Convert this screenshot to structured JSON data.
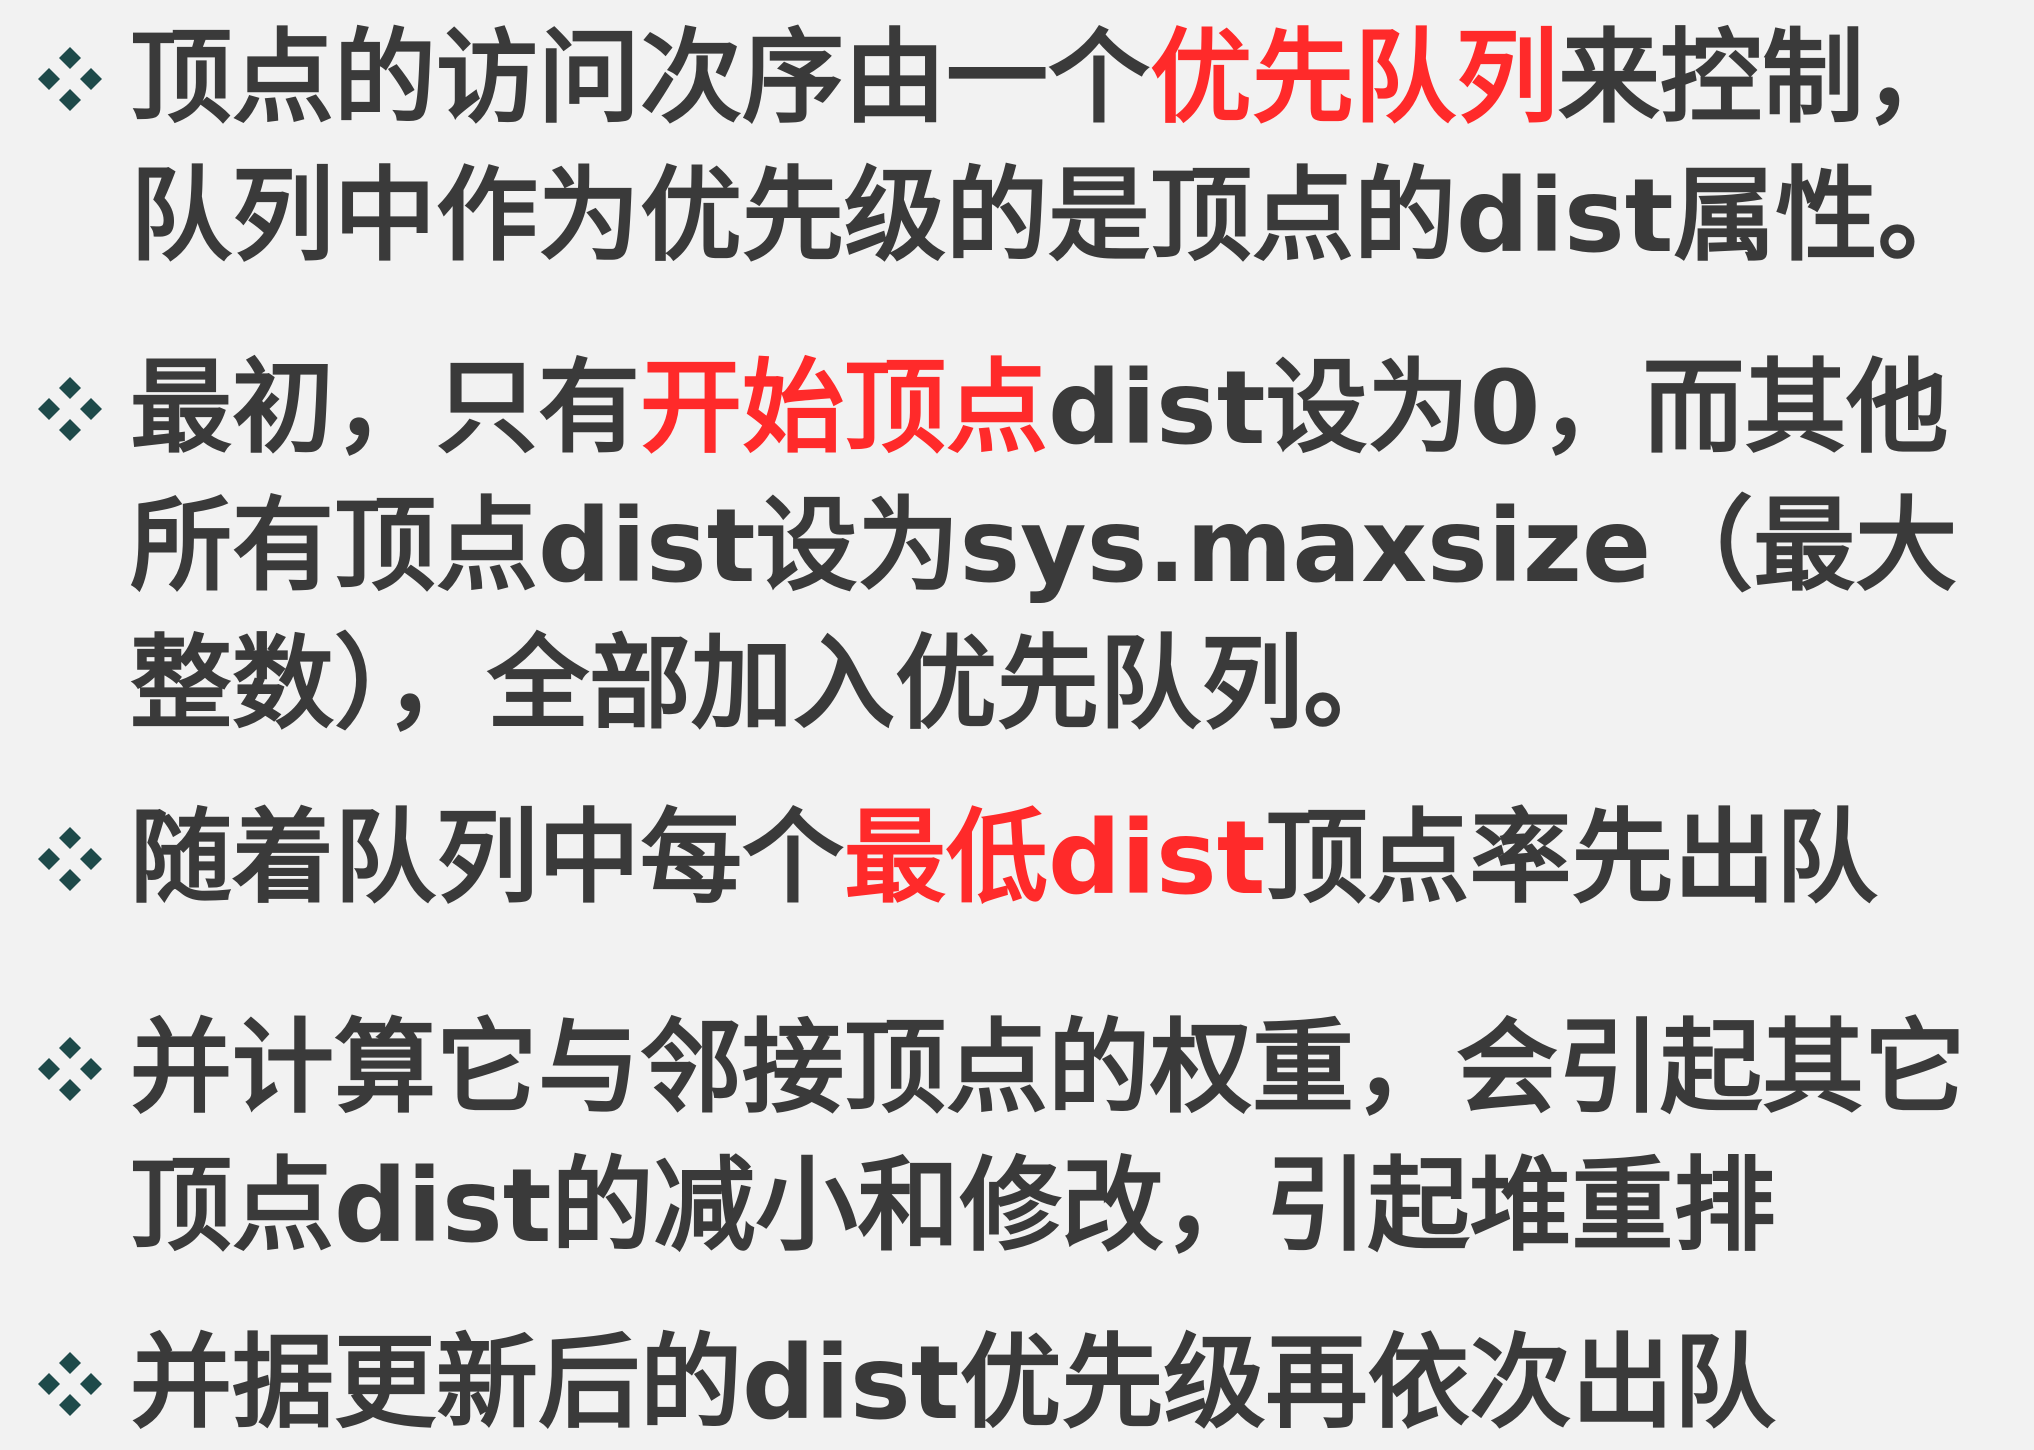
{
  "colors": {
    "text": "#3a3a3a",
    "highlight": "#ff2a2a",
    "marker": "#1e4a4a",
    "background": "#f2f2f2"
  },
  "bullets": [
    {
      "marker_icon": "four-diamond-bullet-icon",
      "segments": [
        {
          "text": "顶点的访问次序由一个",
          "highlight": false
        },
        {
          "text": "优先队列",
          "highlight": true
        },
        {
          "text": "来控制，队列中作为优先级的是顶点的dist属性。",
          "highlight": false
        }
      ]
    },
    {
      "marker_icon": "four-diamond-bullet-icon",
      "segments": [
        {
          "text": "最初，只有",
          "highlight": false
        },
        {
          "text": "开始顶点",
          "highlight": true
        },
        {
          "text": "dist设为0，而其他所有顶点dist设为sys.maxsize（最大整数），全部加入优先队列。",
          "highlight": false
        }
      ]
    },
    {
      "marker_icon": "four-diamond-bullet-icon",
      "segments": [
        {
          "text": "随着队列中每个",
          "highlight": false
        },
        {
          "text": "最低dist",
          "highlight": true
        },
        {
          "text": "顶点率先出队",
          "highlight": false
        }
      ]
    },
    {
      "marker_icon": "four-diamond-bullet-icon",
      "segments": [
        {
          "text": "并计算它与邻接顶点的权重，会引起其它顶点dist的减小和修改，引起堆重排",
          "highlight": false
        }
      ]
    },
    {
      "marker_icon": "four-diamond-bullet-icon",
      "segments": [
        {
          "text": "并据更新后的dist优先级再依次出队",
          "highlight": false
        }
      ]
    }
  ]
}
